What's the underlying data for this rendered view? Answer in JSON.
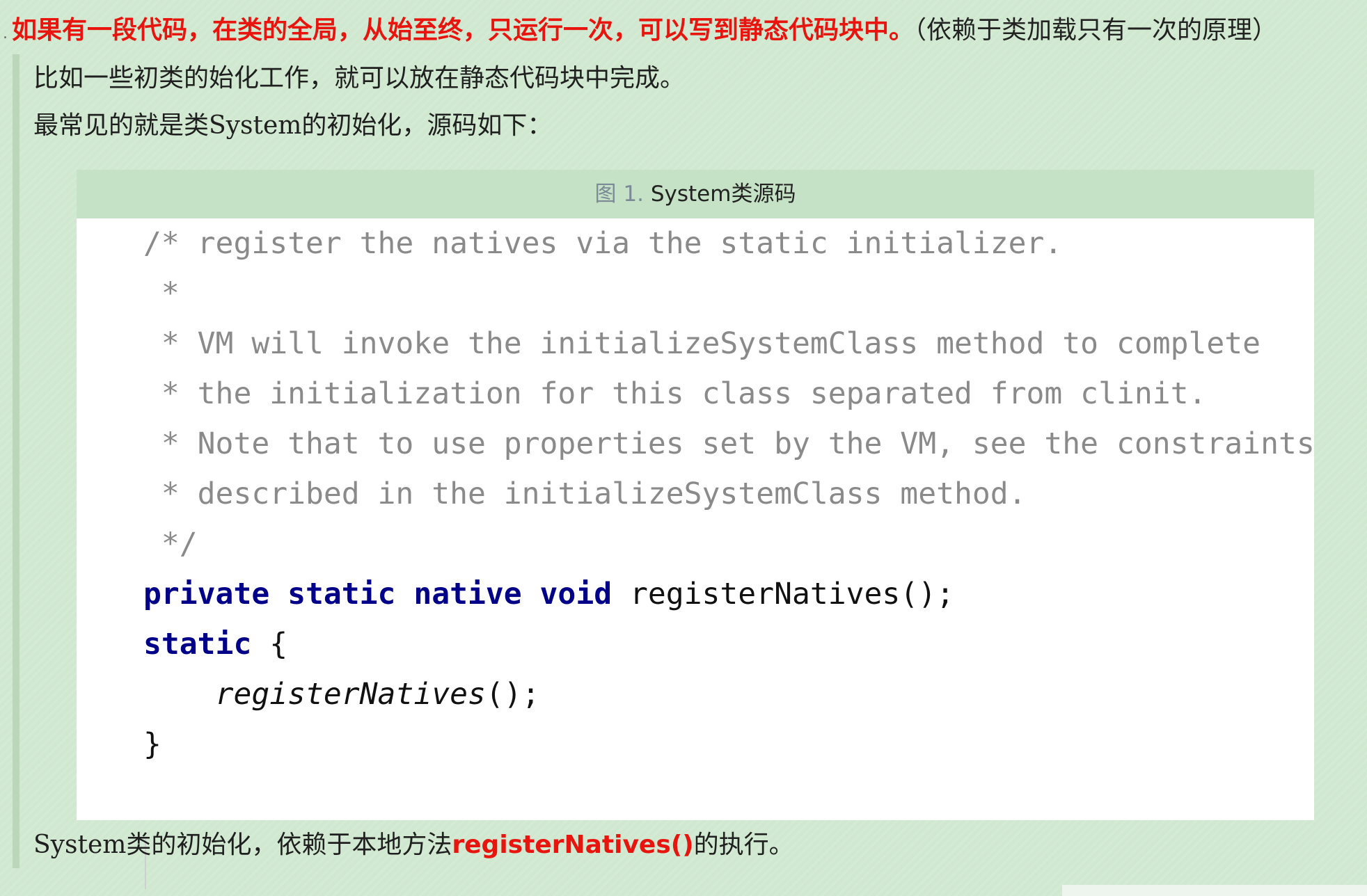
{
  "headline": {
    "bullet": ".",
    "strong": "如果有一段代码，在类的全局，从始至终，只运行一次，可以写到静态代码块中。",
    "note": "（依赖于类加载只有一次的原理）"
  },
  "paragraphs": {
    "p1": "比如一些初类的始化工作，就可以放在静态代码块中完成。",
    "p2": "最常见的就是类System的初始化，源码如下："
  },
  "figure": {
    "caption_number": "图 1.",
    "caption_title": "System类源码",
    "code_lines": [
      "/* register the natives via the static initializer.",
      " *",
      " * VM will invoke the initializeSystemClass method to complete",
      " * the initialization for this class separated from clinit.",
      " * Note that to use properties set by the VM, see the constraints",
      " * described in the initializeSystemClass method.",
      " */"
    ],
    "decl": {
      "kw": "private static native void",
      "rest": " registerNatives();"
    },
    "static_block": {
      "kw": "static",
      "open": " {",
      "call": "registerNatives",
      "call_end": "();",
      "close": "}"
    }
  },
  "conclusion": {
    "before": "System类的初始化，依赖于本地方法",
    "highlight": "registerNatives()",
    "after": "的执行。"
  },
  "colors": {
    "accent_red": "#e8150f",
    "keyword_blue": "#000088",
    "comment_gray": "#8a8a8a",
    "background_green": "#cfe8cf"
  }
}
